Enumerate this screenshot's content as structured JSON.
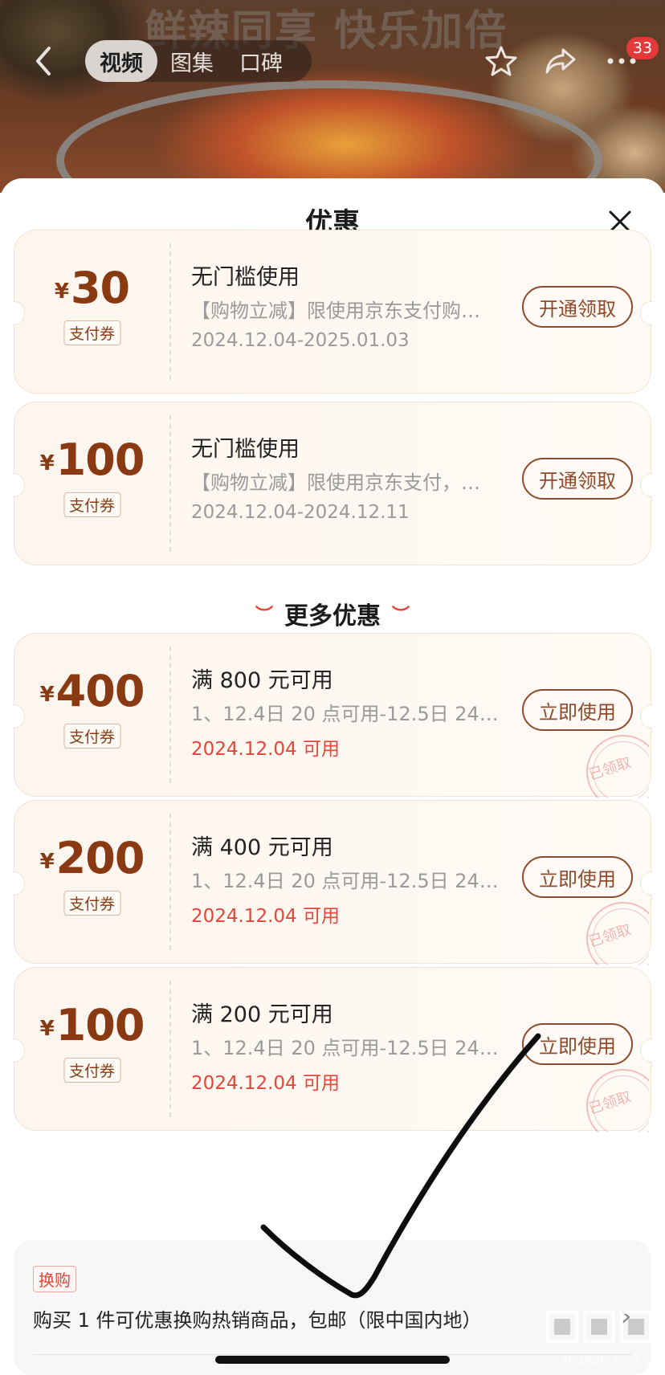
{
  "header": {
    "slogan": "鲜辣同享  快乐加倍",
    "tabs": [
      {
        "label": "视频",
        "active": true
      },
      {
        "label": "图集",
        "active": false
      },
      {
        "label": "口碑",
        "active": false
      }
    ],
    "badge_count": "33",
    "icons": [
      "back-icon",
      "star-icon",
      "share-icon",
      "more-icon"
    ]
  },
  "sheet": {
    "title": "优惠",
    "close_icon": "close-icon"
  },
  "coupons": [
    {
      "currency": "¥",
      "amount": "30",
      "tag": "支付券",
      "title": "无门槛使用",
      "desc": "【购物立减】限使用京东支付购…",
      "date": "2024.12.04-2025.01.03",
      "button": "开通领取",
      "claimed": false
    },
    {
      "currency": "¥",
      "amount": "100",
      "tag": "支付券",
      "title": "无门槛使用",
      "desc": "【购物立减】限使用京东支付，…",
      "date": "2024.12.04-2024.12.11",
      "button": "开通领取",
      "claimed": false
    }
  ],
  "more_section": {
    "label": "更多优惠"
  },
  "more_coupons": [
    {
      "currency": "¥",
      "amount": "400",
      "tag": "支付券",
      "title": "满 800 元可用",
      "desc": "1、12.4日 20 点可用-12.5日 24 …",
      "date": "2024.12.04 可用",
      "button": "立即使用",
      "stamp": "已领取"
    },
    {
      "currency": "¥",
      "amount": "200",
      "tag": "支付券",
      "title": "满 400 元可用",
      "desc": "1、12.4日 20 点可用-12.5日 24 …",
      "date": "2024.12.04 可用",
      "button": "立即使用",
      "stamp": "已领取"
    },
    {
      "currency": "¥",
      "amount": "100",
      "tag": "支付券",
      "title": "满 200 元可用",
      "desc": "1、12.4日 20 点可用-12.5日 24 …",
      "date": "2024.12.04 可用",
      "button": "立即使用",
      "stamp": "已领取"
    }
  ],
  "trade_in": {
    "tag": "换购",
    "text": "购买 1 件可优惠换购热销商品，包邮（限中国内地）"
  },
  "watermark": {
    "logo": "值",
    "site": "zhizhizhi.com"
  },
  "colors": {
    "accent_brown": "#8a3a12",
    "red": "#e2463b",
    "card_bg": "#fdf6ee"
  }
}
